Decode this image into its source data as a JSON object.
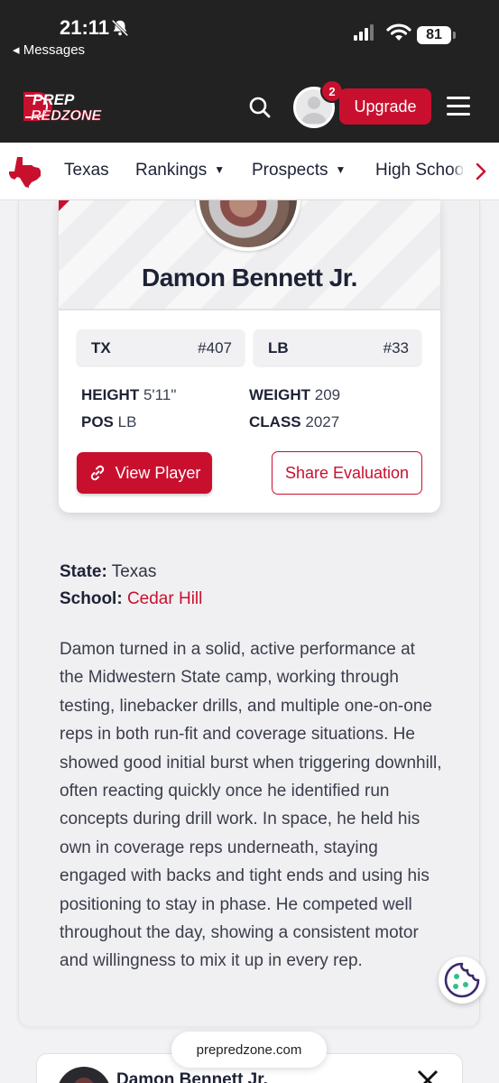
{
  "status_bar": {
    "time": "21:11",
    "back_label": "◂ Messages",
    "battery": "81"
  },
  "header": {
    "logo_line1": "PREP",
    "logo_line2": "REDZONE",
    "notification_count": "2",
    "upgrade_label": "Upgrade"
  },
  "nav": {
    "items": [
      {
        "label": "Texas"
      },
      {
        "label": "Rankings"
      },
      {
        "label": "Prospects"
      },
      {
        "label": "High Schoo"
      }
    ]
  },
  "player": {
    "name": "Damon Bennett Jr.",
    "state_code": "TX",
    "state_rank": "#407",
    "position_code": "LB",
    "position_rank": "#33",
    "height_label": "HEIGHT",
    "height": "5'11\"",
    "weight_label": "WEIGHT",
    "weight": "209",
    "pos_label": "POS",
    "pos": "LB",
    "class_label": "CLASS",
    "class_year": "2027",
    "view_label": "View Player",
    "share_label": "Share Evaluation"
  },
  "info": {
    "state_label": "State:",
    "state": "Texas",
    "school_label": "School:",
    "school": "Cedar Hill"
  },
  "evaluation": "Damon turned in a solid, active performance at the Midwestern State camp, working through testing, linebacker drills, and multiple one-on-one reps in both run-fit and coverage situations. He showed good initial burst when triggering downhill, often reacting quickly once he identified run concepts during drill work. In space, he held his own in coverage reps underneath, staying engaged with backs and tight ends and using his positioning to stay in phase. He competed well throughout the day, showing a consistent motor and willingness to mix it up in every rep.",
  "next_card": {
    "name": "Damon Bennett Jr."
  },
  "url": "prepredzone.com",
  "colors": {
    "brand_red": "#c8102e",
    "header_bg": "#222222",
    "text_dark": "#1d2235"
  }
}
